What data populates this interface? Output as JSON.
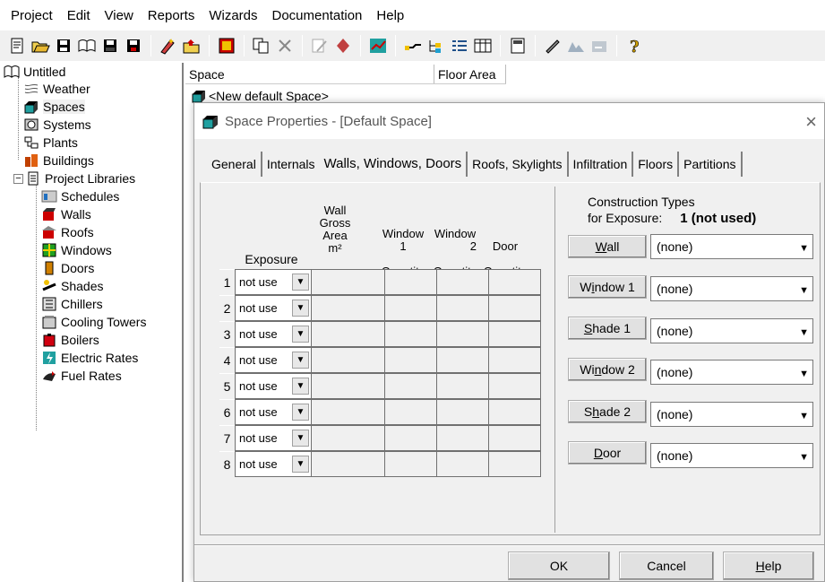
{
  "menu": [
    "Project",
    "Edit",
    "View",
    "Reports",
    "Wizards",
    "Documentation",
    "Help"
  ],
  "toolbar_icons": [
    "new-icon",
    "open-icon",
    "save-icon",
    "library-icon",
    "save-as-icon",
    "save-all-icon",
    "wizard-icon",
    "folder-up-icon",
    "grid-icon",
    "copy-icon",
    "delete-icon",
    "edit-icon",
    "diamond-icon",
    "chart-icon",
    "route-icon",
    "tree-icon",
    "list-icon",
    "table-icon",
    "calculator-icon",
    "pencil-icon",
    "report-icon",
    "export-icon",
    "help-icon"
  ],
  "tree": {
    "root": "Untitled",
    "items": [
      "Weather",
      "Spaces",
      "Systems",
      "Plants",
      "Buildings"
    ],
    "libraries": "Project Libraries",
    "library_items": [
      "Schedules",
      "Walls",
      "Roofs",
      "Windows",
      "Doors",
      "Shades",
      "Chillers",
      "Cooling Towers",
      "Boilers",
      "Electric Rates",
      "Fuel Rates"
    ]
  },
  "list": {
    "col_space": "Space",
    "col_floor_area": "Floor Area",
    "row1": "<New default Space>"
  },
  "dialog": {
    "title": "Space Properties - [Default Space]",
    "close": "×",
    "tabs": [
      "General",
      "Internals",
      "Walls, Windows, Doors",
      "Roofs, Skylights",
      "Infiltration",
      "Floors",
      "Partitions"
    ],
    "headers": {
      "exposure": "Exposure",
      "wall_area": [
        "Wall",
        "Gross",
        "Area",
        "m²"
      ],
      "window1": [
        "Window",
        "1",
        "Quantity"
      ],
      "window2": [
        "Window",
        "2",
        "Quantity"
      ],
      "door": [
        "Door",
        "Quantity"
      ]
    },
    "rows": [
      {
        "num": "1",
        "exposure": "not use"
      },
      {
        "num": "2",
        "exposure": "not use"
      },
      {
        "num": "3",
        "exposure": "not use"
      },
      {
        "num": "4",
        "exposure": "not use"
      },
      {
        "num": "5",
        "exposure": "not use"
      },
      {
        "num": "6",
        "exposure": "not use"
      },
      {
        "num": "7",
        "exposure": "not use"
      },
      {
        "num": "8",
        "exposure": "not use"
      }
    ],
    "construction": {
      "title1": "Construction Types",
      "title2": "for Exposure:",
      "exposure_value": "1 (not used)",
      "items": [
        {
          "button_pre": "",
          "button_u": "W",
          "button_post": "all",
          "value": "(none)"
        },
        {
          "button_pre": "W",
          "button_u": "i",
          "button_post": "ndow 1",
          "value": "(none)"
        },
        {
          "button_pre": "",
          "button_u": "S",
          "button_post": "hade 1",
          "value": "(none)"
        },
        {
          "button_pre": "Wi",
          "button_u": "n",
          "button_post": "dow 2",
          "value": "(none)"
        },
        {
          "button_pre": "S",
          "button_u": "h",
          "button_post": "ade 2",
          "value": "(none)"
        },
        {
          "button_pre": "",
          "button_u": "D",
          "button_post": "oor",
          "value": "(none)"
        }
      ]
    },
    "ok": "OK",
    "cancel": "Cancel",
    "help_u": "H",
    "help_rest": "elp"
  }
}
